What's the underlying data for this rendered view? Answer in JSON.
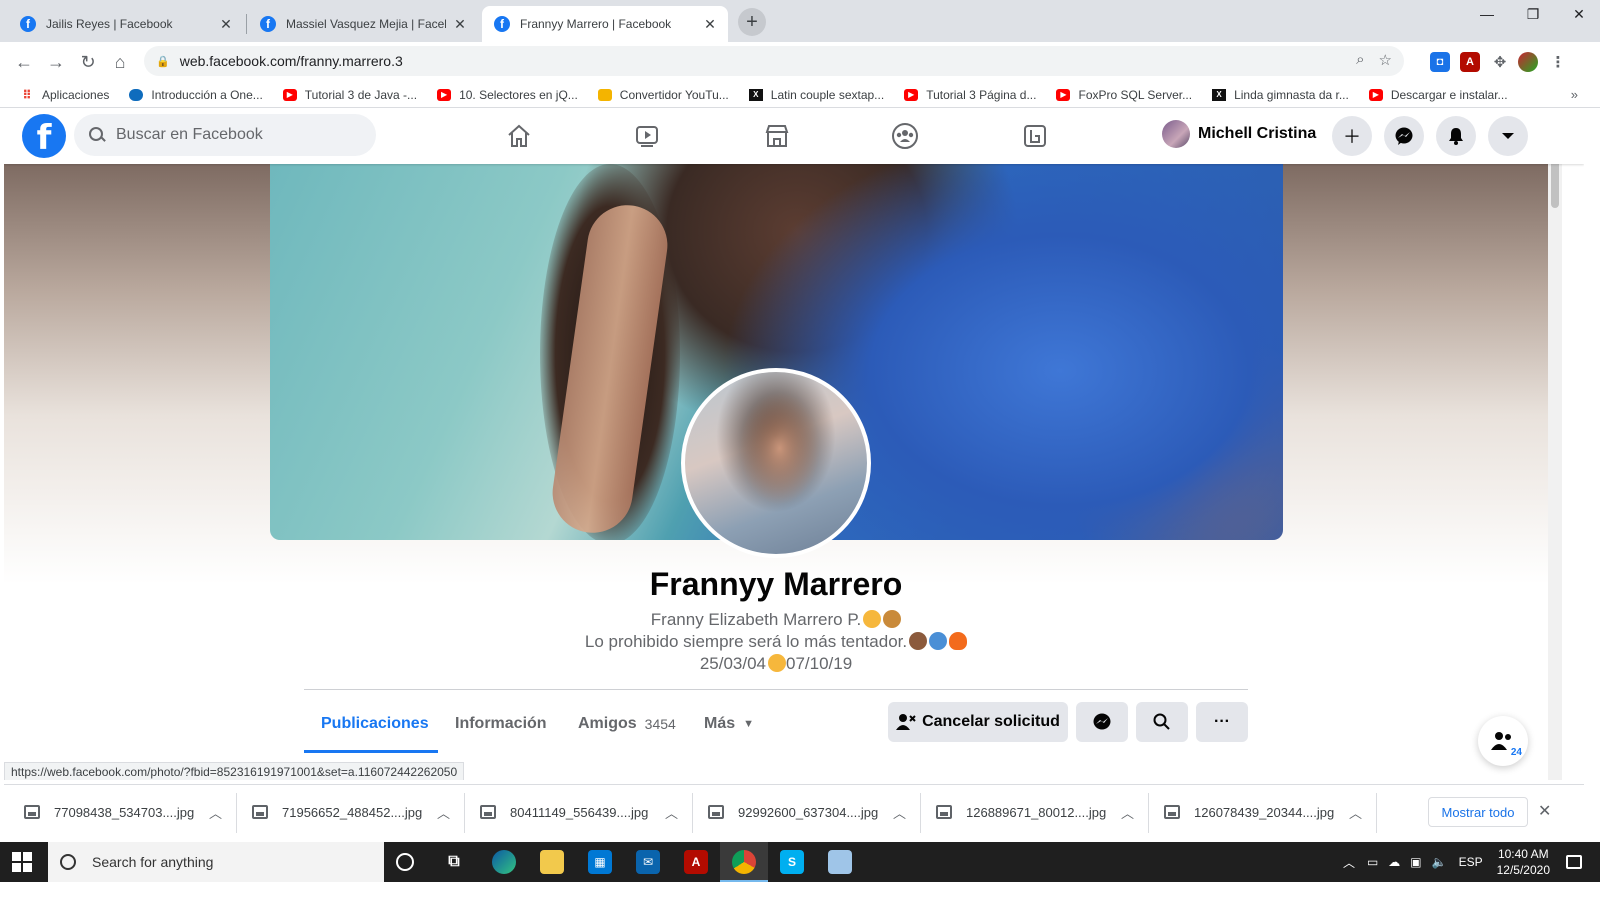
{
  "browser": {
    "tabs": [
      {
        "title": "Jailis Reyes | Facebook",
        "active": false
      },
      {
        "title": "Massiel Vasquez Mejia | Facebook",
        "active": false
      },
      {
        "title": "Frannyy Marrero | Facebook",
        "active": true
      }
    ],
    "url": "web.facebook.com/franny.marrero.3",
    "bookmarks": [
      {
        "label": "Aplicaciones",
        "icon": "apps-grid-icon"
      },
      {
        "label": "Introducción a One...",
        "icon": "onedrive-cloud-icon"
      },
      {
        "label": "Tutorial 3 de Java -...",
        "icon": "youtube-icon"
      },
      {
        "label": "10. Selectores en jQ...",
        "icon": "youtube-icon"
      },
      {
        "label": "Convertidor YouTu...",
        "icon": "converter-icon"
      },
      {
        "label": "Latin couple sextap...",
        "icon": "x-site-icon"
      },
      {
        "label": "Tutorial 3 Página d...",
        "icon": "youtube-icon"
      },
      {
        "label": "FoxPro SQL Server...",
        "icon": "youtube-icon"
      },
      {
        "label": "Linda gimnasta da r...",
        "icon": "x-site-icon"
      },
      {
        "label": "Descargar e instalar...",
        "icon": "youtube-icon"
      }
    ],
    "status_url": "https://web.facebook.com/photo/?fbid=852316191971001&set=a.116072442262050"
  },
  "facebook": {
    "search_placeholder": "Buscar en Facebook",
    "user_name": "Michell Cristina",
    "brand_color": "#1877f2"
  },
  "profile": {
    "name": "Frannyy Marrero",
    "alternate_name": "Franny Elizabeth Marrero P.",
    "bio_line": "Lo prohibido siempre será lo más tentador.",
    "dates_left": "25/03/04",
    "dates_right": "07/10/19",
    "tabs": [
      {
        "label": "Publicaciones",
        "active": true
      },
      {
        "label": "Información"
      },
      {
        "label": "Amigos",
        "count": "3454"
      },
      {
        "label": "Más"
      }
    ],
    "cancel_request_label": "Cancelar solicitud",
    "contacts_badge": "24"
  },
  "downloads": {
    "items": [
      "77098438_534703....jpg",
      "71956652_488452....jpg",
      "80411149_556439....jpg",
      "92992600_637304....jpg",
      "126889671_80012....jpg",
      "126078439_20344....jpg"
    ],
    "show_all_label": "Mostrar todo"
  },
  "taskbar": {
    "search_placeholder": "Search for anything",
    "language": "ESP",
    "time": "10:40 AM",
    "date": "12/5/2020"
  }
}
